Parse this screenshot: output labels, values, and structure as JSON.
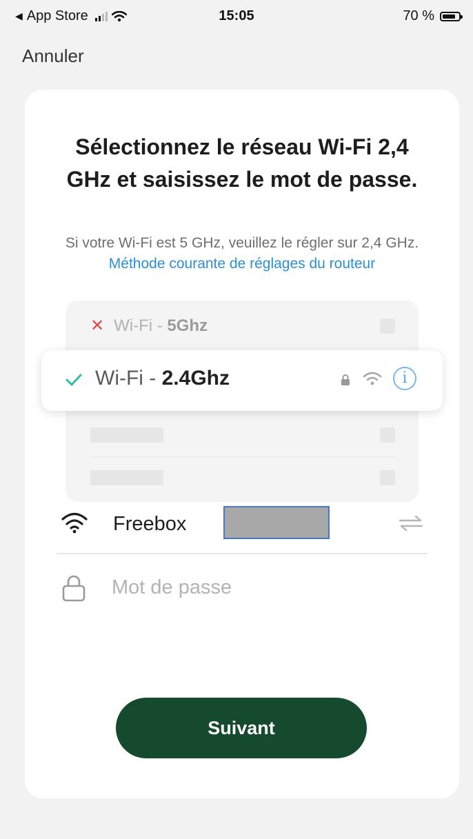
{
  "status_bar": {
    "back_app": "App Store",
    "time": "15:05",
    "battery": "70 %",
    "battery_level": 0.7
  },
  "nav": {
    "cancel_label": "Annuler"
  },
  "title": "Sélectionnez le réseau Wi-Fi 2,4 GHz et saisissez le mot de passe.",
  "subtitle": {
    "text": "Si votre Wi-Fi est 5 GHz, veuillez le régler sur 2,4 GHz.",
    "link": "Méthode courante de réglages du routeur"
  },
  "networks": {
    "wrong": {
      "prefix": "Wi-Fi - ",
      "band": "5Ghz",
      "icon": "x-icon"
    },
    "right": {
      "prefix": "Wi-Fi - ",
      "band": "2.4Ghz",
      "icon": "check-icon"
    }
  },
  "form": {
    "ssid_value": "Freebox",
    "password_placeholder": "Mot de passe"
  },
  "buttons": {
    "next_label": "Suivant"
  },
  "colors": {
    "accent_green": "#154a2e",
    "link_blue": "#2b8fd6",
    "check_green": "#2cc09a",
    "error_red": "#e5484d"
  }
}
